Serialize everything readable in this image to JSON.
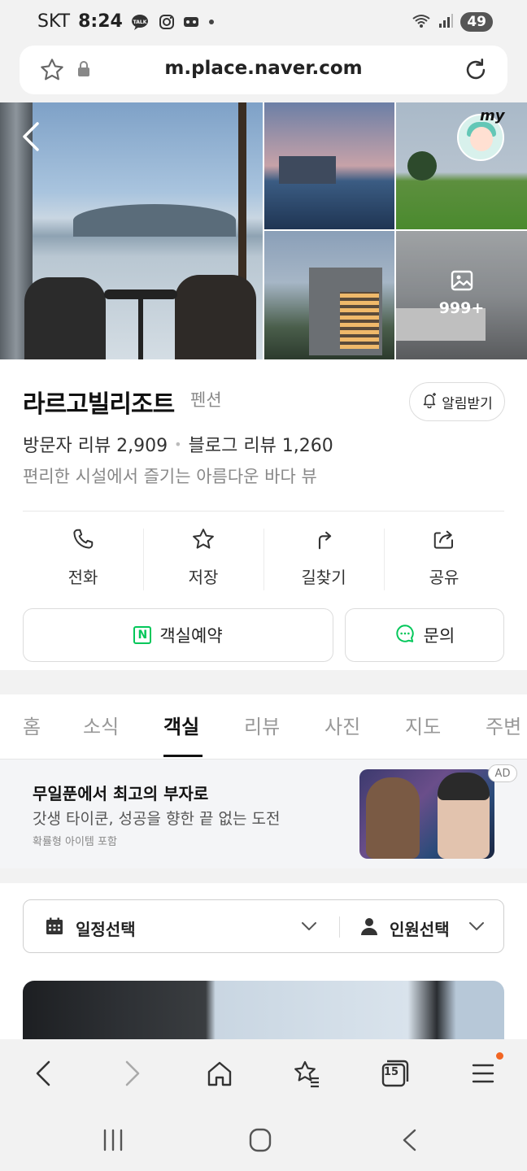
{
  "status_bar": {
    "carrier": "SKT",
    "time": "8:24",
    "battery": "49"
  },
  "browser": {
    "url": "m.place.naver.com",
    "tabs_count": "15"
  },
  "gallery": {
    "more_label": "999+",
    "my_tag": "my"
  },
  "place": {
    "name": "라르고빌리조트",
    "category": "펜션",
    "alert_label": "알림받기",
    "visitor_reviews": "방문자 리뷰 2,909",
    "blog_reviews": "블로그 리뷰 1,260",
    "description": "편리한 시설에서 즐기는 아름다운 바다 뷰"
  },
  "actions": [
    {
      "label": "전화",
      "icon": "phone-icon"
    },
    {
      "label": "저장",
      "icon": "star-icon"
    },
    {
      "label": "길찾기",
      "icon": "directions-icon"
    },
    {
      "label": "공유",
      "icon": "share-icon"
    }
  ],
  "booking": {
    "reserve_label": "객실예약",
    "naver_badge": "N",
    "inquiry_label": "문의"
  },
  "tabs": [
    "홈",
    "소식",
    "객실",
    "리뷰",
    "사진",
    "지도",
    "주변"
  ],
  "active_tab": "객실",
  "ad": {
    "title": "무일푼에서 최고의 부자로",
    "subtitle": "갓생 타이쿤, 성공을 향한 끝 없는 도전",
    "note": "확률형 아이템 포함",
    "badge": "AD"
  },
  "filter": {
    "date_label": "일정선택",
    "people_label": "인원선택"
  },
  "colors": {
    "naver_green": "#03c75a",
    "menu_dot": "#f26522"
  }
}
